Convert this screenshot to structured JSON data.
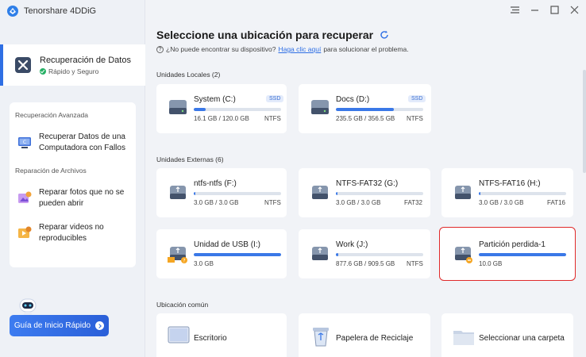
{
  "app": {
    "title": "Tenorshare 4DDiG"
  },
  "sidebar": {
    "main_item": {
      "label": "Recuperación de Datos",
      "sub": "Rápido y Seguro"
    },
    "advanced_label": "Recuperación Avanzada",
    "advanced_items": [
      {
        "line1": "Recuperar Datos de una",
        "line2": "Computadora con Fallos"
      }
    ],
    "repair_label": "Reparación de Archivos",
    "repair_items": [
      {
        "line1": "Reparar fotos que no se",
        "line2": "pueden abrir"
      },
      {
        "line1": "Reparar videos no",
        "line2": "reproducibles"
      }
    ],
    "guide_button": "Guía de Inicio Rápido"
  },
  "main": {
    "title": "Seleccione una ubicación para recuperar",
    "hint_prefix": "¿No puede encontrar su dispositivo?",
    "hint_link": "Haga clic aquí",
    "hint_suffix": "para solucionar el problema.",
    "local_section": "Unidades Locales (2)",
    "local_drives": [
      {
        "name": "System (C:)",
        "badge": "SSD",
        "usage": "16.1 GB / 120.0 GB",
        "fs": "NTFS",
        "used": 0.134
      },
      {
        "name": "Docs (D:)",
        "badge": "SSD",
        "usage": "235.5 GB / 356.5 GB",
        "fs": "NTFS",
        "used": 0.66
      }
    ],
    "external_section": "Unidades Externas (6)",
    "external_drives": [
      {
        "name": "ntfs-ntfs (F:)",
        "usage": "3.0 GB / 3.0 GB",
        "fs": "NTFS",
        "used": 0.02
      },
      {
        "name": "NTFS-FAT32 (G:)",
        "usage": "3.0 GB / 3.0 GB",
        "fs": "FAT32",
        "used": 0.02
      },
      {
        "name": "NTFS-FAT16 (H:)",
        "usage": "3.0 GB / 3.0 GB",
        "fs": "FAT16",
        "used": 0.02
      },
      {
        "name": "Unidad de USB (I:)",
        "usage": "3.0 GB",
        "fs": "",
        "used": 1.0
      },
      {
        "name": "Work (J:)",
        "usage": "877.6 GB / 909.5 GB",
        "fs": "NTFS",
        "used": 0.03
      },
      {
        "name": "Partición perdida-1",
        "usage": "10.0 GB",
        "fs": "",
        "used": 1.0
      }
    ],
    "common_section": "Ubicación común",
    "common_locations": [
      {
        "label": "Escritorio"
      },
      {
        "label": "Papelera de Reciclaje"
      },
      {
        "label": "Seleccionar una carpeta"
      }
    ]
  },
  "colors": {
    "accent": "#2f6fe4",
    "bar": "#3a78e7",
    "highlight": "#e02a2a"
  }
}
